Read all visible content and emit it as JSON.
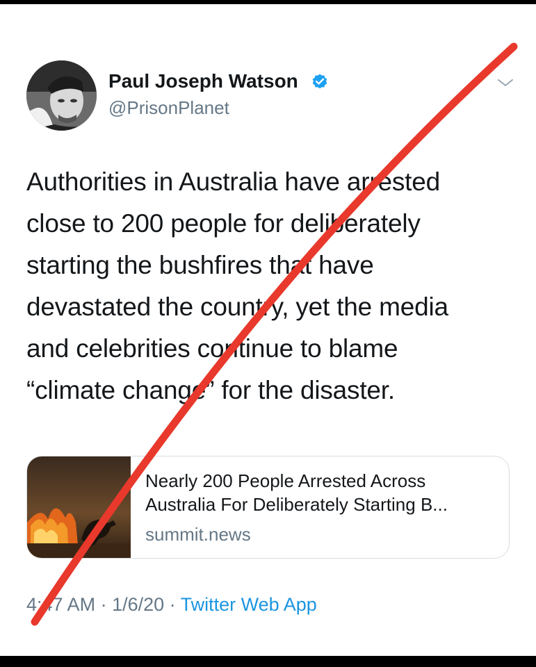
{
  "tweet": {
    "author": {
      "name": "Paul Joseph Watson",
      "handle": "@PrisonPlanet",
      "verified": true
    },
    "text_lines": [
      "Authorities in Australia have arrested",
      "close to 200 people for deliberately",
      "starting the bushfires that have",
      "devastated the country, yet the media",
      "and celebrities continue to blame",
      "“climate change” for the disaster."
    ],
    "card": {
      "title_lines": [
        "Nearly 200 People Arrested Across",
        "Australia For Deliberately Starting B..."
      ],
      "domain": "summit.news"
    },
    "meta": {
      "time": "4:47 AM",
      "separator": " · ",
      "date": "1/6/20",
      "source": "Twitter Web App"
    }
  },
  "colors": {
    "text": "#14171a",
    "secondary": "#657786",
    "link": "#1b95e0",
    "verified": "#1da1f2",
    "strike": "#e8392c"
  },
  "icons": {
    "verified": "verified-badge-icon",
    "menu": "chevron-down-icon"
  }
}
